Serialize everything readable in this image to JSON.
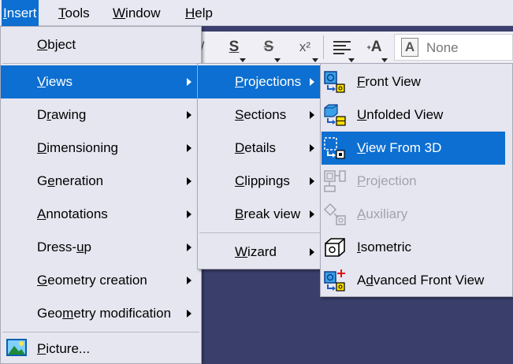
{
  "menubar": {
    "items": [
      {
        "label": "Insert",
        "ul": "I",
        "rest": "nsert"
      },
      {
        "label": "Tools",
        "ul": "T",
        "rest": "ools"
      },
      {
        "label": "Window",
        "ul": "W",
        "rest": "indow"
      },
      {
        "label": "Help",
        "ul": "H",
        "rest": "elp"
      }
    ]
  },
  "toolbar": {
    "strike_s": "S",
    "underline_s": "S",
    "superscript": "x²",
    "font_value": "None",
    "font_icon": "A",
    "text_a": "A"
  },
  "insert_menu": {
    "items": [
      {
        "pre": "",
        "ul": "O",
        "post": "bject",
        "label": "Object"
      },
      {
        "pre": "",
        "ul": "V",
        "post": "iews",
        "label": "Views"
      },
      {
        "pre": "D",
        "ul": "r",
        "post": "awing",
        "label": "Drawing"
      },
      {
        "pre": "",
        "ul": "D",
        "post": "imensioning",
        "label": "Dimensioning"
      },
      {
        "pre": "G",
        "ul": "e",
        "post": "neration",
        "label": "Generation"
      },
      {
        "pre": "",
        "ul": "A",
        "post": "nnotations",
        "label": "Annotations"
      },
      {
        "pre": "Dress-",
        "ul": "u",
        "post": "p",
        "label": "Dress-up"
      },
      {
        "pre": "",
        "ul": "G",
        "post": "eometry creation",
        "label": "Geometry creation"
      },
      {
        "pre": "Geo",
        "ul": "m",
        "post": "etry modification",
        "label": "Geometry modification"
      },
      {
        "pre": "",
        "ul": "P",
        "post": "icture...",
        "label": "Picture..."
      }
    ]
  },
  "views_menu": {
    "items": [
      {
        "pre": "",
        "ul": "P",
        "post": "rojections",
        "label": "Projections"
      },
      {
        "pre": "",
        "ul": "S",
        "post": "ections",
        "label": "Sections"
      },
      {
        "pre": "",
        "ul": "D",
        "post": "etails",
        "label": "Details"
      },
      {
        "pre": "",
        "ul": "C",
        "post": "lippings",
        "label": "Clippings"
      },
      {
        "pre": "",
        "ul": "B",
        "post": "reak view",
        "label": "Break view"
      },
      {
        "pre": "",
        "ul": "W",
        "post": "izard",
        "label": "Wizard"
      }
    ]
  },
  "projections_menu": {
    "items": [
      {
        "pre": "",
        "ul": "F",
        "post": "ront View",
        "label": "Front View",
        "icon": "front-view-icon"
      },
      {
        "pre": "",
        "ul": "U",
        "post": "nfolded View",
        "label": "Unfolded View",
        "icon": "unfolded-view-icon"
      },
      {
        "pre": "",
        "ul": "V",
        "post": "iew From 3D",
        "label": "View From 3D",
        "icon": "view-from-3d-icon"
      },
      {
        "pre": "",
        "ul": "P",
        "post": "rojection",
        "label": "Projection",
        "icon": "projection-icon"
      },
      {
        "pre": "",
        "ul": "A",
        "post": "uxiliary",
        "label": "Auxiliary",
        "icon": "auxiliary-icon"
      },
      {
        "pre": "",
        "ul": "I",
        "post": "sometric",
        "label": "Isometric",
        "icon": "isometric-icon"
      },
      {
        "pre": "A",
        "ul": "d",
        "post": "vanced Front View",
        "label": "Advanced Front View",
        "icon": "advanced-front-view-icon"
      }
    ]
  },
  "colors": {
    "highlight": "#0c6fd1",
    "menu_bg": "#e6e6f0",
    "disabled_text": "#a3a3b0",
    "app_bg": "#3b3f6e"
  }
}
